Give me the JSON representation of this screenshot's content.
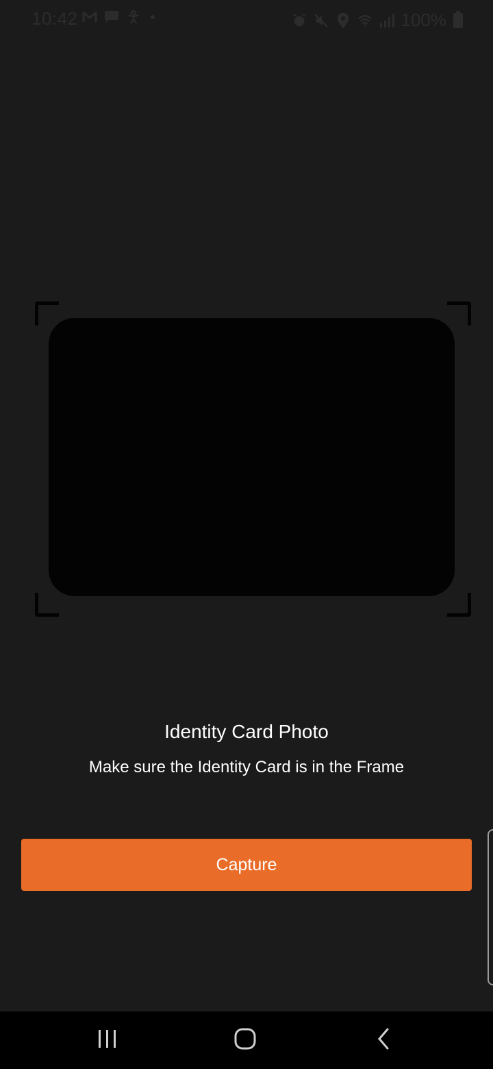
{
  "status_bar": {
    "time": "10:42",
    "battery_text": "100%",
    "left_icons": [
      "gmail-icon",
      "message-icon",
      "accessibility-icon"
    ],
    "right_icons": [
      "alarm-icon",
      "mute-icon",
      "location-icon",
      "wifi-icon",
      "signal-icon",
      "battery-icon"
    ]
  },
  "capture_screen": {
    "title": "Identity Card Photo",
    "subtitle": "Make sure the Identity Card is in the Frame",
    "capture_label": "Capture"
  },
  "nav_bar": {
    "buttons": [
      "recents-icon",
      "home-icon",
      "back-icon"
    ]
  },
  "colors": {
    "background": "#1b1b1b",
    "frame": "#030304",
    "accent": "#e96c28",
    "text": "#ffffff"
  }
}
